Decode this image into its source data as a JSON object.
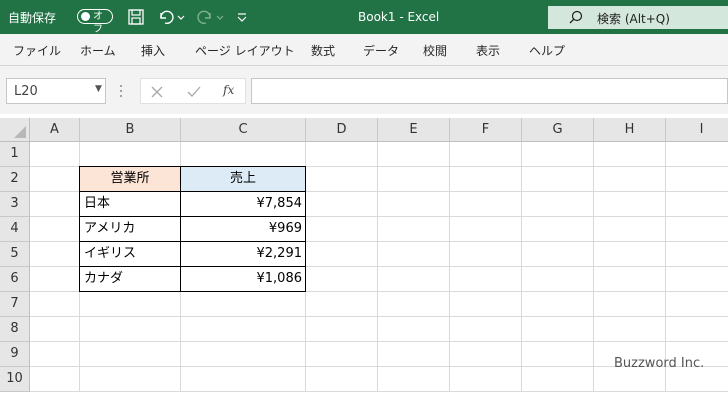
{
  "titlebar": {
    "autosave_label": "自動保存",
    "toggle_state": "オフ",
    "title": "Book1  -  Excel",
    "search_label": "検索 (Alt+Q)",
    "bg_color": "#217346"
  },
  "menu": {
    "items": [
      "ファイル",
      "ホーム",
      "挿入",
      "ページ レイアウト",
      "数式",
      "データ",
      "校閲",
      "表示",
      "ヘルプ"
    ]
  },
  "formula_bar": {
    "name_box": "L20",
    "fx_label": "fx",
    "formula": ""
  },
  "grid": {
    "columns": [
      "A",
      "B",
      "C",
      "D",
      "E",
      "F",
      "G",
      "H",
      "I"
    ],
    "rows": [
      "1",
      "2",
      "3",
      "4",
      "5",
      "6",
      "7",
      "8",
      "9",
      "10"
    ],
    "table": {
      "header": [
        "営業所",
        "売上"
      ],
      "rows": [
        [
          "日本",
          "¥7,854"
        ],
        [
          "アメリカ",
          "¥969"
        ],
        [
          "イギリス",
          "¥2,291"
        ],
        [
          "カナダ",
          "¥1,086"
        ]
      ],
      "header_colors": [
        "#fce4d6",
        "#ddebf7"
      ]
    }
  },
  "watermark": "Buzzword Inc."
}
